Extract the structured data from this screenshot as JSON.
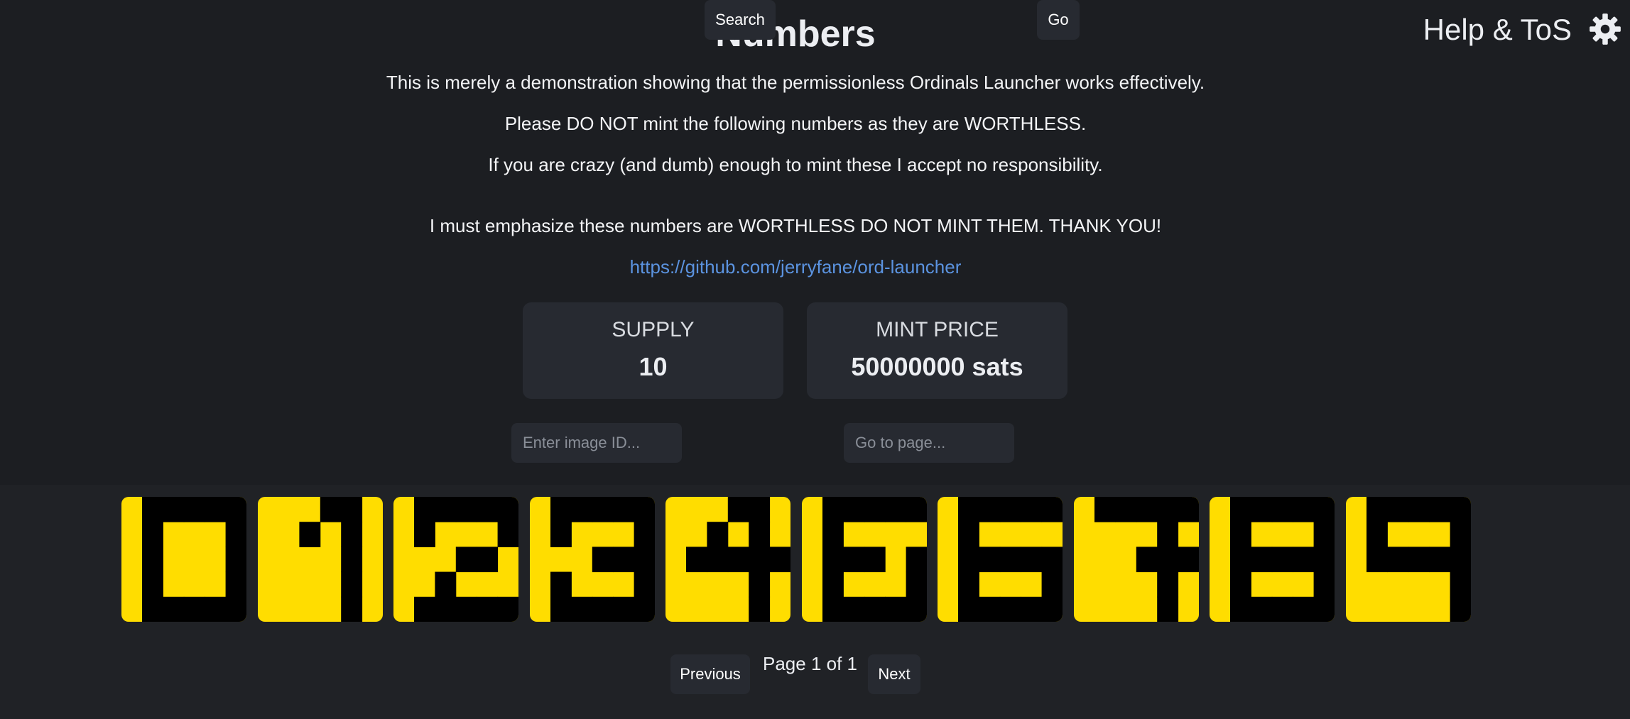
{
  "header": {
    "title": "Numbers",
    "help_link": "Help & ToS",
    "settings_icon": "gear-icon"
  },
  "description": {
    "line1": "This is merely a demonstration showing that the permissionless Ordinals Launcher works effectively.",
    "line2": "Please DO NOT mint the following numbers as they are WORTHLESS.",
    "line3": "If you are crazy (and dumb) enough to mint these I accept no responsibility.",
    "line4": "I must emphasize these numbers are WORTHLESS DO NOT MINT THEM. THANK YOU!",
    "repo_link": "https://github.com/jerryfane/ord-launcher"
  },
  "stats": {
    "supply_label": "SUPPLY",
    "supply_value": "10",
    "price_label": "MINT PRICE",
    "price_value": "50000000 sats"
  },
  "search": {
    "placeholder": "Enter image ID...",
    "button": "Search"
  },
  "pagination_input": {
    "placeholder": "Go to page...",
    "button": "Go"
  },
  "gallery": {
    "tile_color": "#ffdd00",
    "ink_color": "#000000",
    "tiles": [
      {
        "id": 0,
        "glyph": [
          "11111",
          "10001",
          "10001",
          "10001",
          "11111"
        ]
      },
      {
        "id": 1,
        "glyph": [
          "00110",
          "01010",
          "00010",
          "00010",
          "00010"
        ]
      },
      {
        "id": 2,
        "glyph": [
          "11111",
          "10001",
          "00110",
          "01000",
          "11111"
        ]
      },
      {
        "id": 3,
        "glyph": [
          "11111",
          "10001",
          "00111",
          "10001",
          "11111"
        ]
      },
      {
        "id": 4,
        "glyph": [
          "00110",
          "01010",
          "11111",
          "00010",
          "00010"
        ]
      },
      {
        "id": 5,
        "glyph": [
          "11111",
          "10000",
          "11101",
          "10001",
          "11111"
        ]
      },
      {
        "id": 6,
        "glyph": [
          "11111",
          "10000",
          "11111",
          "10001",
          "11111"
        ]
      },
      {
        "id": 7,
        "glyph": [
          "11111",
          "00010",
          "00111",
          "00010",
          "00010"
        ]
      },
      {
        "id": 8,
        "glyph": [
          "11111",
          "10001",
          "11111",
          "10001",
          "11111"
        ]
      },
      {
        "id": 9,
        "glyph": [
          "11111",
          "10001",
          "11111",
          "00001",
          "00001"
        ]
      }
    ]
  },
  "pagination": {
    "previous": "Previous",
    "status": "Page 1 of 1",
    "next": "Next"
  }
}
